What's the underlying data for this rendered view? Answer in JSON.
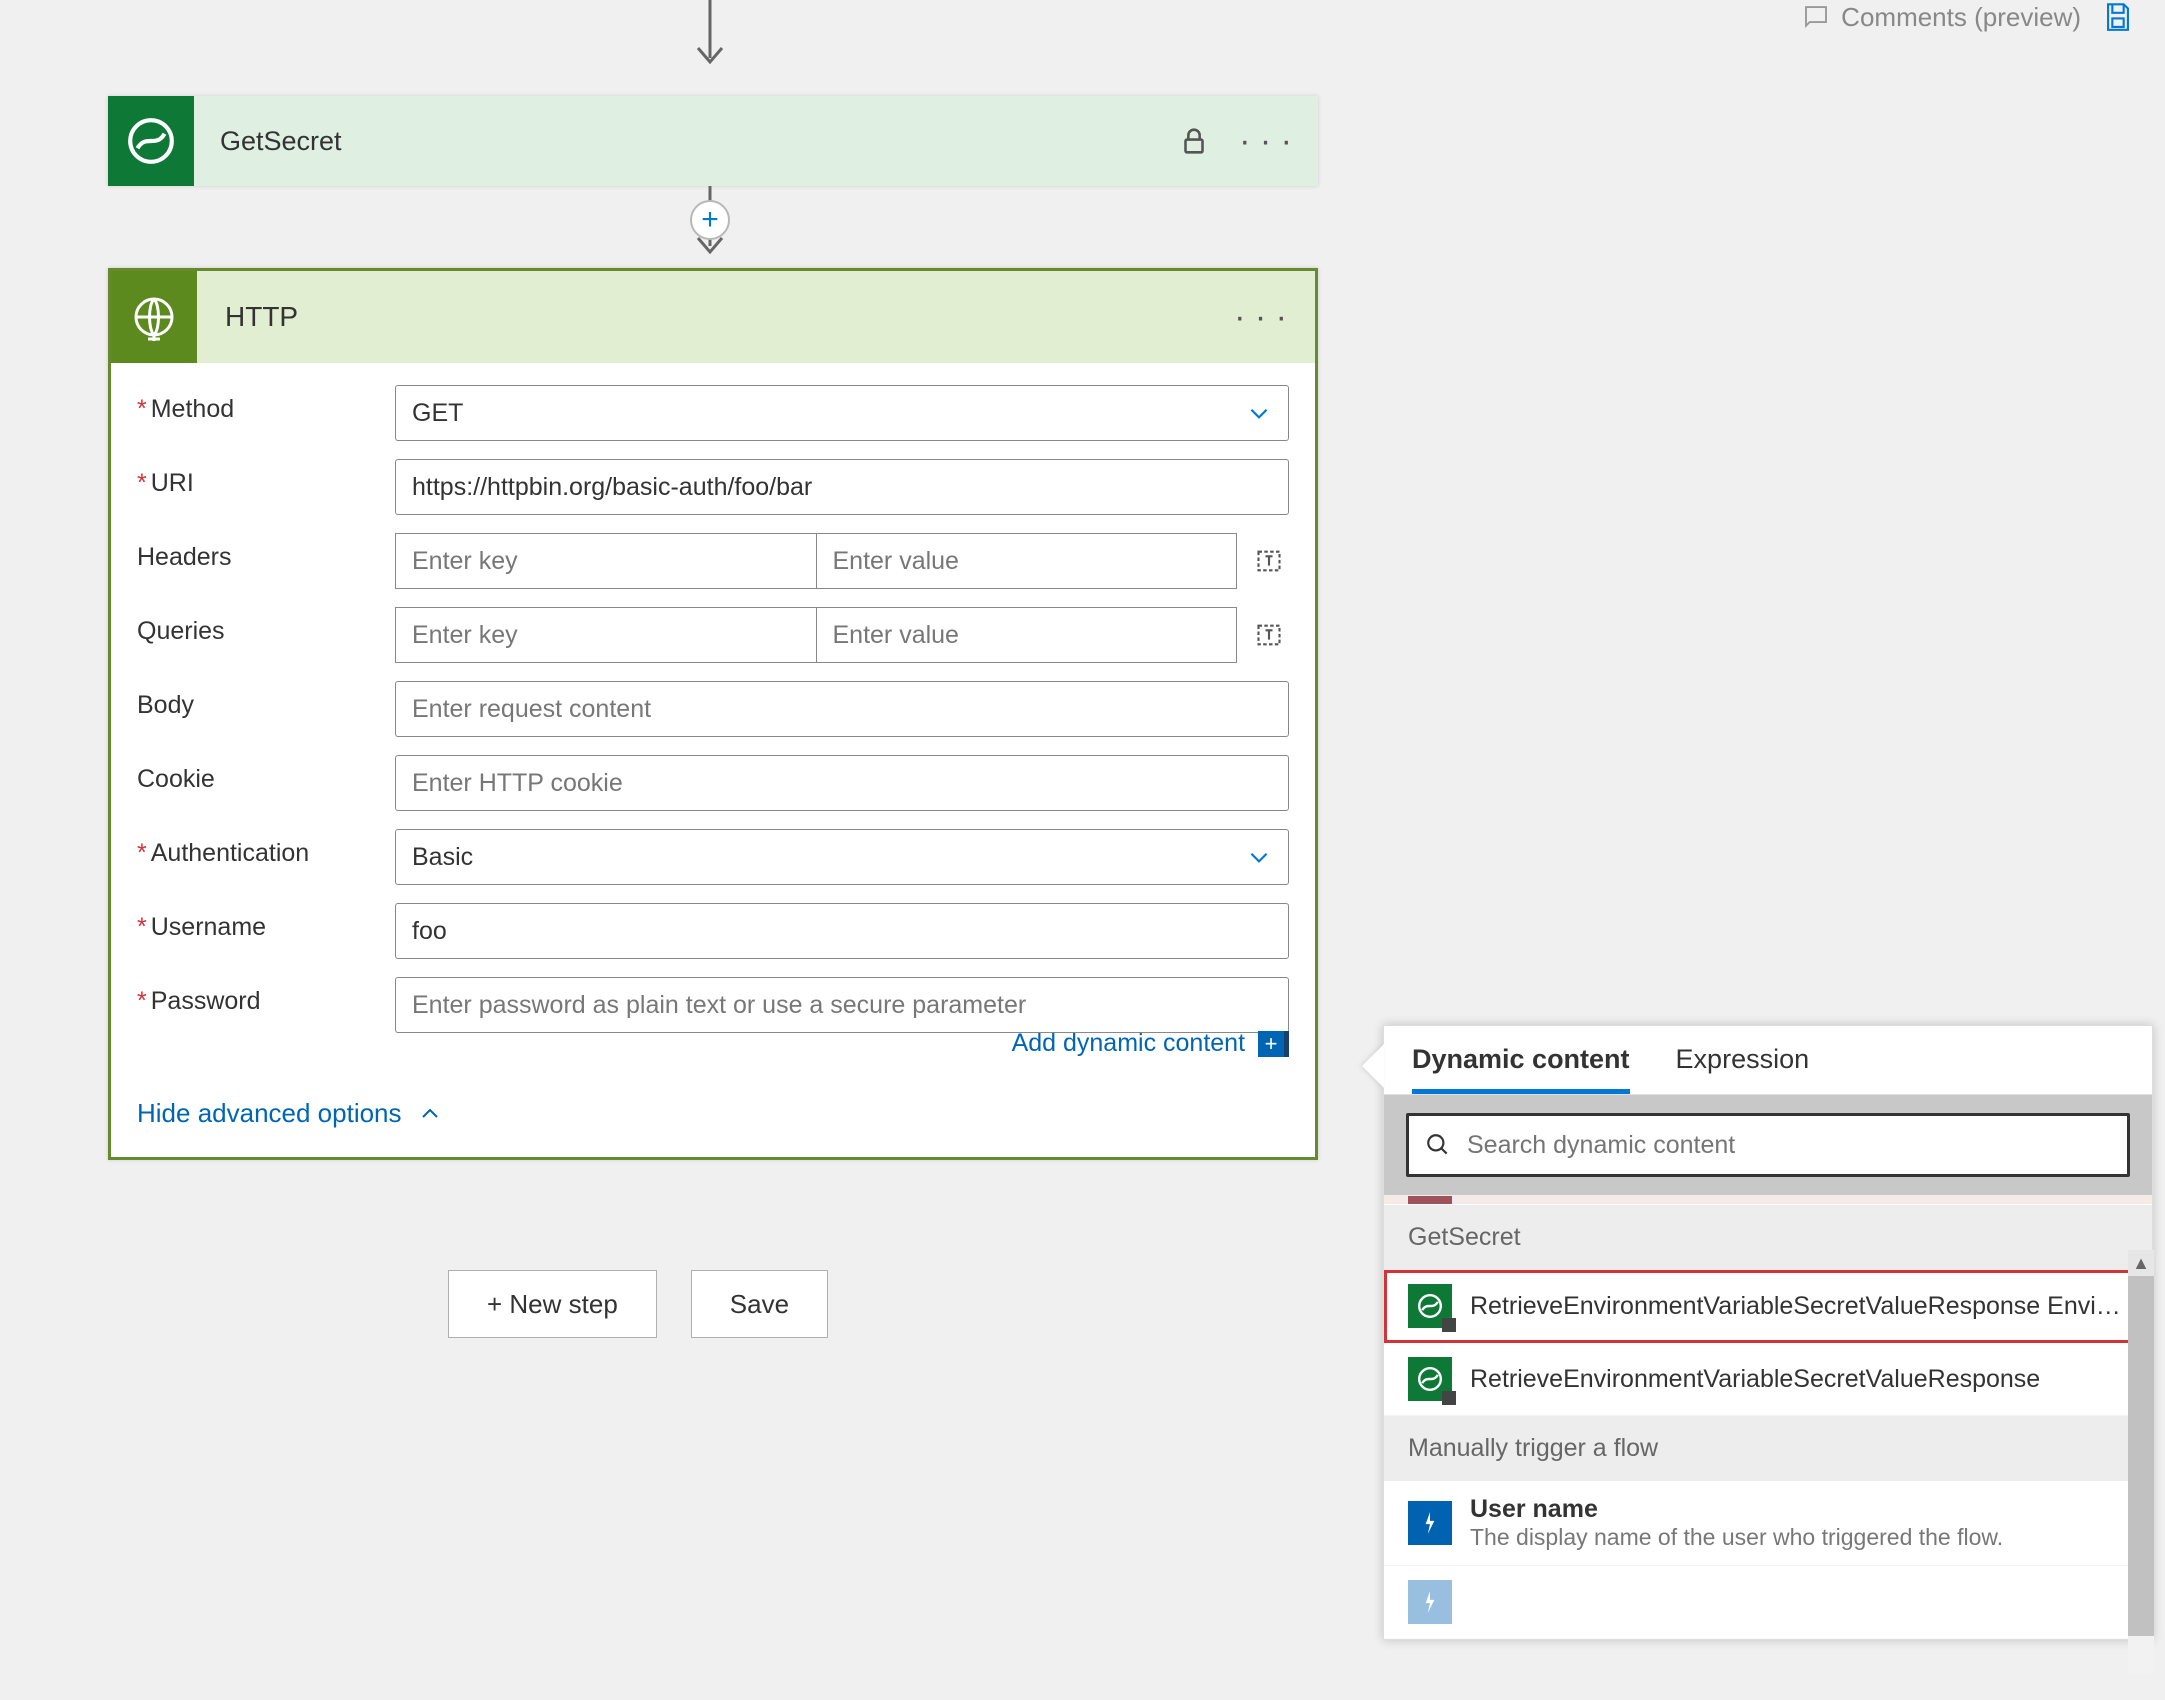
{
  "topbar": {
    "comments_label": "Comments (preview)"
  },
  "cards": {
    "getsecret": {
      "title": "GetSecret"
    },
    "http": {
      "title": "HTTP",
      "fields": {
        "method": {
          "label": "Method",
          "value": "GET"
        },
        "uri": {
          "label": "URI",
          "value": "https://httpbin.org/basic-auth/foo/bar"
        },
        "headers": {
          "label": "Headers",
          "key_placeholder": "Enter key",
          "value_placeholder": "Enter value"
        },
        "queries": {
          "label": "Queries",
          "key_placeholder": "Enter key",
          "value_placeholder": "Enter value"
        },
        "body": {
          "label": "Body",
          "placeholder": "Enter request content"
        },
        "cookie": {
          "label": "Cookie",
          "placeholder": "Enter HTTP cookie"
        },
        "authentication": {
          "label": "Authentication",
          "value": "Basic"
        },
        "username": {
          "label": "Username",
          "value": "foo"
        },
        "password": {
          "label": "Password",
          "placeholder": "Enter password as plain text or use a secure parameter"
        }
      },
      "add_dynamic_label": "Add dynamic content",
      "hide_advanced_label": "Hide advanced options"
    }
  },
  "footer": {
    "new_step": "+ New step",
    "save": "Save"
  },
  "dynamic_panel": {
    "tabs": {
      "dynamic": "Dynamic content",
      "expression": "Expression"
    },
    "search_placeholder": "Search dynamic content",
    "sections": [
      {
        "title": "GetSecret",
        "items": [
          {
            "label": "RetrieveEnvironmentVariableSecretValueResponse Envi…",
            "highlight": true
          },
          {
            "label": "RetrieveEnvironmentVariableSecretValueResponse"
          }
        ]
      },
      {
        "title": "Manually trigger a flow",
        "items": [
          {
            "label": "User name",
            "sub": "The display name of the user who triggered the flow.",
            "blue": true
          }
        ]
      }
    ]
  }
}
